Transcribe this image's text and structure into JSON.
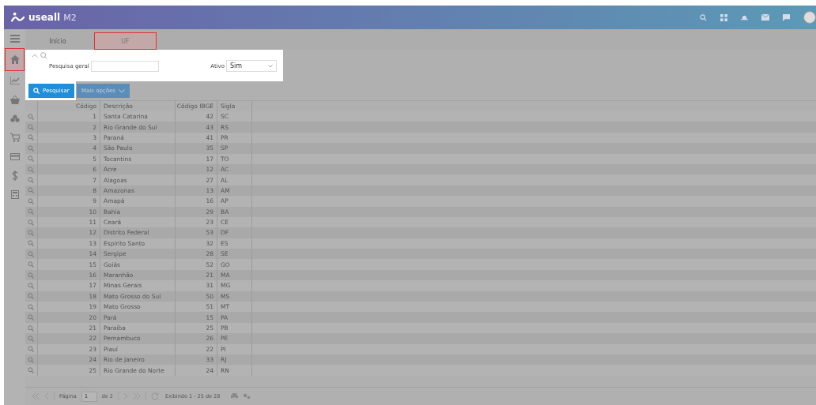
{
  "header": {
    "logo": "useall",
    "logo_suffix": "M2"
  },
  "tabs": [
    {
      "label": "Início",
      "selected": false
    },
    {
      "label": "UF",
      "selected": true
    }
  ],
  "sidebar": {
    "items": [
      {
        "kind": "menu",
        "selected": false
      },
      {
        "kind": "home",
        "selected": true
      },
      {
        "kind": "chart",
        "selected": false
      },
      {
        "kind": "basket",
        "selected": false
      },
      {
        "kind": "boxes",
        "selected": false
      },
      {
        "kind": "cart",
        "selected": false
      },
      {
        "kind": "card",
        "selected": false
      },
      {
        "kind": "dollar",
        "selected": false
      },
      {
        "kind": "calculator",
        "selected": false
      }
    ]
  },
  "filter": {
    "search_label": "Pesquisa geral",
    "active_label": "Ativo",
    "active_value": "Sim"
  },
  "buttons": {
    "search": "Pesquisar",
    "more": "Mais opções"
  },
  "table": {
    "columns": [
      "Código",
      "Descrição",
      "Código IBGE",
      "Sigla"
    ],
    "rows": [
      [
        "1",
        "Santa Catarina",
        "42",
        "SC"
      ],
      [
        "2",
        "Rio Grande do Sul",
        "43",
        "RS"
      ],
      [
        "3",
        "Paraná",
        "41",
        "PR"
      ],
      [
        "4",
        "São Paulo",
        "35",
        "SP"
      ],
      [
        "5",
        "Tocantins",
        "17",
        "TO"
      ],
      [
        "6",
        "Acre",
        "12",
        "AC"
      ],
      [
        "7",
        "Alagoas",
        "27",
        "AL"
      ],
      [
        "8",
        "Amazonas",
        "13",
        "AM"
      ],
      [
        "9",
        "Amapá",
        "16",
        "AP"
      ],
      [
        "10",
        "Bahia",
        "29",
        "BA"
      ],
      [
        "11",
        "Ceará",
        "23",
        "CE"
      ],
      [
        "12",
        "Distrito Federal",
        "53",
        "DF"
      ],
      [
        "13",
        "Espírito Santo",
        "32",
        "ES"
      ],
      [
        "14",
        "Sergipe",
        "28",
        "SE"
      ],
      [
        "15",
        "Goiás",
        "52",
        "GO"
      ],
      [
        "16",
        "Maranhão",
        "21",
        "MA"
      ],
      [
        "17",
        "Minas Gerais",
        "31",
        "MG"
      ],
      [
        "18",
        "Mato Grosso do Sul",
        "50",
        "MS"
      ],
      [
        "19",
        "Mato Grosso",
        "51",
        "MT"
      ],
      [
        "20",
        "Pará",
        "15",
        "PA"
      ],
      [
        "21",
        "Paraíba",
        "25",
        "PB"
      ],
      [
        "22",
        "Pernambuco",
        "26",
        "PE"
      ],
      [
        "23",
        "Piauí",
        "22",
        "PI"
      ],
      [
        "24",
        "Rio de Janeiro",
        "33",
        "RJ"
      ],
      [
        "25",
        "Rio Grande do Norte",
        "24",
        "RN"
      ]
    ]
  },
  "pager": {
    "page_label": "Página",
    "page": "1",
    "of": "de 2",
    "summary": "Exibindo 1 - 25 de 28"
  }
}
